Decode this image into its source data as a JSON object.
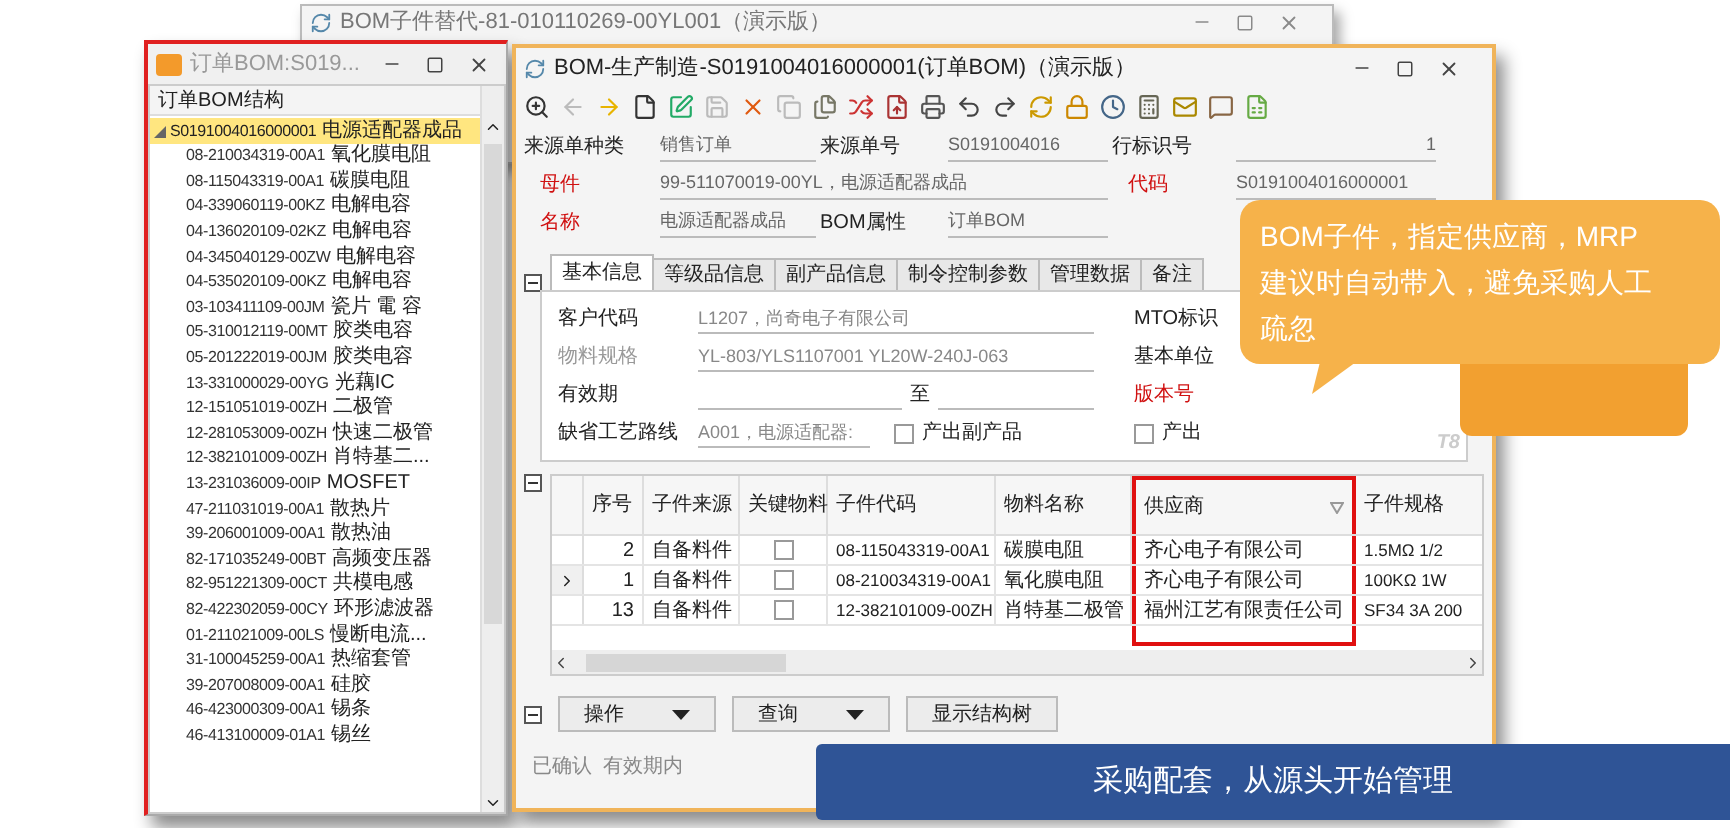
{
  "back_window": {
    "title": "BOM子件替代-81-010110269-00YL001（演示版）"
  },
  "tree_window": {
    "title": "订单BOM:S019...",
    "panel_title": "订单BOM结构",
    "tree": [
      {
        "code": "S0191004016000001",
        "name": "电源适配器成品",
        "selected": true,
        "expanded": true,
        "children": [
          {
            "code": "08-210034319-00A1",
            "name": "氧化膜电阻",
            "selected": false
          },
          {
            "code": "08-115043319-00A1",
            "name": "碳膜电阻",
            "selected": false
          },
          {
            "code": "04-339060119-00KZ",
            "name": "电解电容",
            "selected": false
          },
          {
            "code": "04-136020109-02KZ",
            "name": "电解电容",
            "selected": false
          },
          {
            "code": "04-345040129-00ZW",
            "name": "电解电容",
            "selected": false
          },
          {
            "code": "04-535020109-00KZ",
            "name": "电解电容",
            "selected": false
          },
          {
            "code": "03-103411109-00JM",
            "name": "瓷片 電 容",
            "selected": false
          },
          {
            "code": "05-310012119-00MT",
            "name": "胶类电容",
            "selected": false
          },
          {
            "code": "05-201222019-00JM",
            "name": "胶类电容",
            "selected": false
          },
          {
            "code": "13-331000029-00YG",
            "name": "光藕IC",
            "selected": false
          },
          {
            "code": "12-151051019-00ZH",
            "name": "二极管",
            "selected": false
          },
          {
            "code": "12-281053009-00ZH",
            "name": "快速二极管",
            "selected": false
          },
          {
            "code": "12-382101009-00ZH",
            "name": "肖特基二...",
            "selected": false
          },
          {
            "code": "13-231036009-00IP",
            "name": "MOSFET",
            "selected": false
          },
          {
            "code": "47-211031019-00A1",
            "name": "散热片",
            "selected": false
          },
          {
            "code": "39-206001009-00A1",
            "name": "散热油",
            "selected": false
          },
          {
            "code": "82-171035249-00BT",
            "name": "高频变压器",
            "selected": false
          },
          {
            "code": "82-951221309-00CT",
            "name": "共模电感",
            "selected": false
          },
          {
            "code": "82-422302059-00CY",
            "name": "环形滤波器",
            "selected": false
          },
          {
            "code": "01-211021009-00LS",
            "name": "慢断电流...",
            "selected": false
          },
          {
            "code": "31-100045259-00A1",
            "name": "热缩套管",
            "selected": false
          },
          {
            "code": "39-207008009-00A1",
            "name": "硅胶",
            "selected": false
          },
          {
            "code": "46-423000309-00A1",
            "name": "锡条",
            "selected": false
          },
          {
            "code": "46-413100009-01A1",
            "name": "锡丝",
            "selected": false
          }
        ]
      }
    ]
  },
  "main_window": {
    "title": "BOM-生产制造-S0191004016000001(订单BOM)（演示版）",
    "header_rows": [
      [
        {
          "label": "来源单种类",
          "value": "销售订单",
          "required": false,
          "wide": false
        },
        {
          "label": "来源单号",
          "value": "S0191004016",
          "required": false,
          "wide": false
        },
        {
          "label": "行标识号",
          "value": "1",
          "required": false,
          "wide": false
        }
      ],
      [
        {
          "label": "母件",
          "value": "99-511070019-00YL，电源适配器成品",
          "required": true,
          "wide": true
        },
        {
          "label": "代码",
          "value": "S0191004016000001",
          "required": true,
          "wide": false
        }
      ],
      [
        {
          "label": "名称",
          "value": "电源适配器成品",
          "required": true,
          "wide": false
        },
        {
          "label": "BOM属性",
          "value": "订单BOM",
          "required": false,
          "wide": false
        }
      ]
    ],
    "tabs": [
      {
        "label": "基本信息",
        "selected": true
      },
      {
        "label": "等级品信息",
        "selected": false
      },
      {
        "label": "副产品信息",
        "selected": false
      },
      {
        "label": "制令控制参数",
        "selected": false
      },
      {
        "label": "管理数据",
        "selected": false
      },
      {
        "label": "备注",
        "selected": false
      }
    ],
    "form_left": [
      {
        "kind": "text",
        "label": "客户代码",
        "value": "L1207，尚奇电子有限公司",
        "disabled": false
      },
      {
        "kind": "text",
        "label": "物料规格",
        "value": "YL-803/YLS1107001 YL20W-240J-063",
        "disabled": true
      },
      {
        "kind": "range",
        "label": "有效期",
        "separator": "至",
        "disabled": false
      },
      {
        "kind": "text_check",
        "label": "缺省工艺路线",
        "value": "A001，电源适配器:",
        "disabled": false,
        "check": {
          "label": "产出副产品",
          "checked": false
        }
      }
    ],
    "form_right": [
      {
        "kind": "label",
        "label": "MTO标识",
        "required": false
      },
      {
        "kind": "label",
        "label": "基本单位",
        "required": false
      },
      {
        "kind": "label",
        "label": "版本号",
        "required": true
      },
      {
        "kind": "check",
        "label": "产出",
        "checked": false
      }
    ],
    "panel_logo": "T8",
    "table": {
      "columns": [
        {
          "label": "序号",
          "highlighted": false,
          "filter": false
        },
        {
          "label": "子件来源",
          "highlighted": false,
          "filter": false
        },
        {
          "label": "关键物料",
          "highlighted": false,
          "filter": false
        },
        {
          "label": "子件代码",
          "highlighted": false,
          "filter": false
        },
        {
          "label": "物料名称",
          "highlighted": false,
          "filter": false
        },
        {
          "label": "供应商",
          "highlighted": true,
          "filter": true
        },
        {
          "label": "子件规格",
          "highlighted": false,
          "filter": false
        }
      ],
      "rows": [
        {
          "current": false,
          "seq": "2",
          "source": "自备料件",
          "key_material": false,
          "code": "08-115043319-00A1",
          "name": "碳膜电阻",
          "supplier": "齐心电子有限公司",
          "spec": "1.5MΩ 1/2"
        },
        {
          "current": true,
          "seq": "1",
          "source": "自备料件",
          "key_material": false,
          "code": "08-210034319-00A1",
          "name": "氧化膜电阻",
          "supplier": "齐心电子有限公司",
          "spec": "100KΩ 1W"
        },
        {
          "current": false,
          "seq": "13",
          "source": "自备料件",
          "key_material": false,
          "code": "12-382101009-00ZH",
          "name": "肖特基二极管",
          "supplier": "福州江艺有限责任公司",
          "spec": "SF34 3A 200"
        }
      ]
    },
    "buttons": [
      {
        "label": "操作",
        "dropdown": true
      },
      {
        "label": "查询",
        "dropdown": true
      },
      {
        "label": "显示结构树",
        "dropdown": false
      }
    ],
    "status": "已确认  有效期内"
  },
  "callout": {
    "lines": [
      "BOM子件，指定供应商，MRP",
      "建议时自动带入，避免采购人工",
      "疏忽"
    ]
  },
  "banner": {
    "text": "采购配套，从源头开始管理"
  }
}
